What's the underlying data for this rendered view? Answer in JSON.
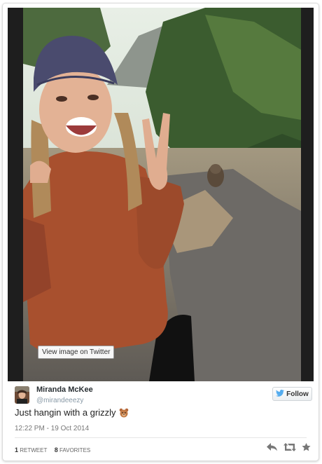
{
  "media": {
    "view_label": "View image on Twitter"
  },
  "tweet": {
    "author_name": "Miranda McKee",
    "handle": "@mirandeeezy",
    "follow_label": "Follow",
    "text": "Just hangin with a grizzly",
    "emoji_icon": "bear-face-icon",
    "timestamp": "12:22 PM - 19 Oct 2014",
    "retweet_count": "1",
    "retweet_label": "RETWEET",
    "favorite_count": "8",
    "favorite_label": "FAVORITES"
  },
  "icons": {
    "follow": "twitter-bird-icon",
    "reply": "reply-icon",
    "retweet": "retweet-icon",
    "favorite": "star-icon"
  },
  "colors": {
    "twitter_blue": "#55acee",
    "action_gray": "#777777",
    "handle_gray": "#8899a6"
  }
}
